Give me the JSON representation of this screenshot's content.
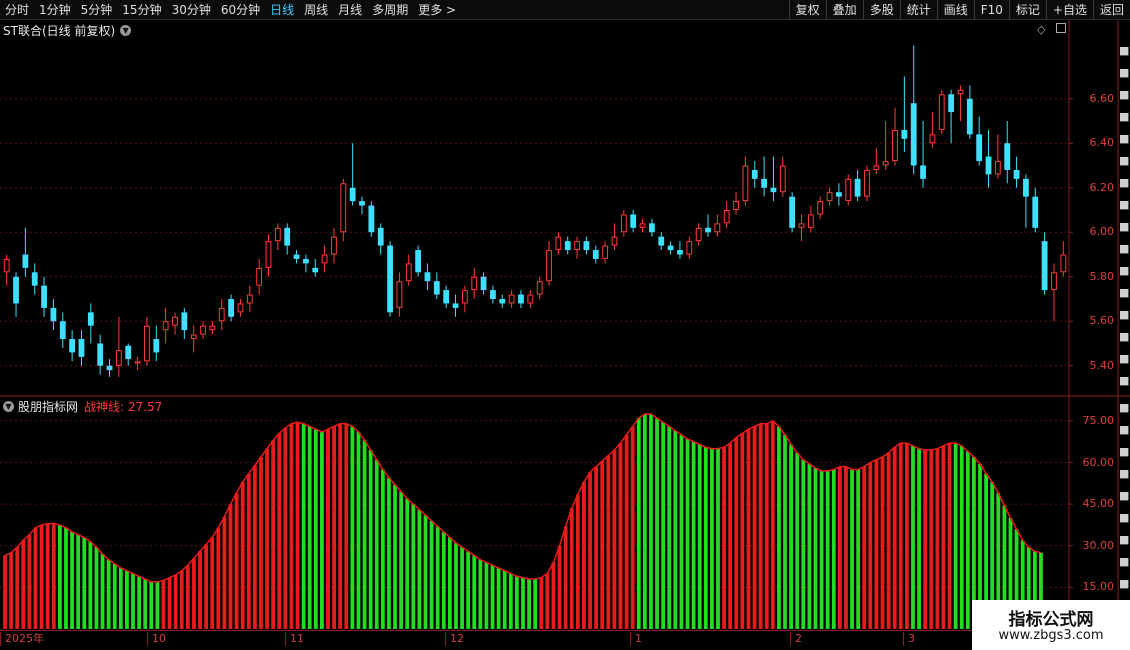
{
  "toolbar": {
    "left": [
      "分时",
      "1分钟",
      "5分钟",
      "15分钟",
      "30分钟",
      "60分钟",
      "日线",
      "周线",
      "月线",
      "多周期",
      "更多 >"
    ],
    "active": "日线",
    "right": [
      "复权",
      "叠加",
      "多股",
      "统计",
      "画线",
      "F10",
      "标记",
      "+自选",
      "返回"
    ]
  },
  "main": {
    "title": "ST联合(日线 前复权)",
    "price_axis": [
      "6.60",
      "6.40",
      "6.20",
      "6.00",
      "5.80",
      "5.60",
      "5.40"
    ]
  },
  "indicator": {
    "site": "股朋指标网",
    "line_label": "战神线: 27.57",
    "axis": [
      "75.00",
      "60.00",
      "45.00",
      "30.00",
      "15.00"
    ]
  },
  "dates": [
    "2025年",
    "10",
    "11",
    "12",
    "1",
    "2",
    "3"
  ],
  "watermark": {
    "line1": "指标公式网",
    "line2": "www.zbgs3.com"
  },
  "colors": {
    "up": "#ff3b3b",
    "down": "#3ee0ff",
    "bar_up": "#e81c1c",
    "bar_down": "#22dd22",
    "axis": "#e04040",
    "grid": "#5a1010"
  },
  "chart_data": [
    {
      "type": "candlestick",
      "ylim": [
        5.3,
        6.9
      ],
      "candles": [
        [
          5.82,
          5.88,
          5.76,
          5.9
        ],
        [
          5.8,
          5.68,
          5.62,
          5.82
        ],
        [
          5.9,
          5.84,
          5.8,
          6.02
        ],
        [
          5.82,
          5.76,
          5.72,
          5.86
        ],
        [
          5.76,
          5.66,
          5.62,
          5.8
        ],
        [
          5.66,
          5.6,
          5.56,
          5.7
        ],
        [
          5.6,
          5.52,
          5.48,
          5.64
        ],
        [
          5.52,
          5.46,
          5.42,
          5.56
        ],
        [
          5.52,
          5.44,
          5.4,
          5.56
        ],
        [
          5.64,
          5.58,
          5.5,
          5.68
        ],
        [
          5.5,
          5.4,
          5.36,
          5.54
        ],
        [
          5.4,
          5.38,
          5.35,
          5.43
        ],
        [
          5.4,
          5.47,
          5.35,
          5.62
        ],
        [
          5.49,
          5.43,
          5.4,
          5.5
        ],
        [
          5.41,
          5.42,
          5.38,
          5.44
        ],
        [
          5.42,
          5.58,
          5.4,
          5.62
        ],
        [
          5.52,
          5.46,
          5.42,
          5.58
        ],
        [
          5.56,
          5.6,
          5.5,
          5.66
        ],
        [
          5.58,
          5.62,
          5.54,
          5.64
        ],
        [
          5.64,
          5.56,
          5.52,
          5.66
        ],
        [
          5.52,
          5.54,
          5.46,
          5.58
        ],
        [
          5.54,
          5.58,
          5.52,
          5.6
        ],
        [
          5.56,
          5.58,
          5.54,
          5.6
        ],
        [
          5.6,
          5.66,
          5.56,
          5.7
        ],
        [
          5.7,
          5.62,
          5.6,
          5.72
        ],
        [
          5.64,
          5.68,
          5.62,
          5.7
        ],
        [
          5.68,
          5.72,
          5.64,
          5.76
        ],
        [
          5.76,
          5.84,
          5.72,
          5.88
        ],
        [
          5.84,
          5.96,
          5.8,
          5.99
        ],
        [
          5.96,
          6.02,
          5.92,
          6.04
        ],
        [
          6.02,
          5.94,
          5.9,
          6.04
        ],
        [
          5.9,
          5.88,
          5.86,
          5.92
        ],
        [
          5.88,
          5.86,
          5.82,
          5.9
        ],
        [
          5.84,
          5.82,
          5.8,
          5.88
        ],
        [
          5.86,
          5.9,
          5.82,
          5.94
        ],
        [
          5.9,
          5.98,
          5.86,
          6.02
        ],
        [
          6.0,
          6.22,
          5.96,
          6.24
        ],
        [
          6.2,
          6.14,
          6.12,
          6.4
        ],
        [
          6.14,
          6.12,
          6.08,
          6.16
        ],
        [
          6.12,
          6.0,
          5.98,
          6.14
        ],
        [
          6.02,
          5.94,
          5.9,
          6.04
        ],
        [
          5.94,
          5.64,
          5.62,
          5.96
        ],
        [
          5.66,
          5.78,
          5.62,
          5.82
        ],
        [
          5.78,
          5.86,
          5.76,
          5.9
        ],
        [
          5.92,
          5.82,
          5.8,
          5.94
        ],
        [
          5.82,
          5.78,
          5.74,
          5.86
        ],
        [
          5.78,
          5.72,
          5.7,
          5.82
        ],
        [
          5.74,
          5.68,
          5.66,
          5.76
        ],
        [
          5.68,
          5.66,
          5.62,
          5.72
        ],
        [
          5.68,
          5.74,
          5.64,
          5.76
        ],
        [
          5.74,
          5.8,
          5.7,
          5.84
        ],
        [
          5.8,
          5.74,
          5.72,
          5.82
        ],
        [
          5.74,
          5.7,
          5.68,
          5.76
        ],
        [
          5.7,
          5.68,
          5.66,
          5.72
        ],
        [
          5.68,
          5.72,
          5.66,
          5.74
        ],
        [
          5.72,
          5.68,
          5.66,
          5.74
        ],
        [
          5.68,
          5.72,
          5.66,
          5.74
        ],
        [
          5.72,
          5.78,
          5.7,
          5.8
        ],
        [
          5.78,
          5.92,
          5.76,
          5.96
        ],
        [
          5.92,
          5.98,
          5.9,
          6.0
        ],
        [
          5.96,
          5.92,
          5.9,
          5.98
        ],
        [
          5.92,
          5.96,
          5.88,
          5.98
        ],
        [
          5.96,
          5.92,
          5.9,
          5.98
        ],
        [
          5.92,
          5.88,
          5.86,
          5.94
        ],
        [
          5.88,
          5.94,
          5.86,
          5.96
        ],
        [
          5.94,
          5.98,
          5.92,
          6.04
        ],
        [
          6.0,
          6.08,
          5.98,
          6.1
        ],
        [
          6.08,
          6.02,
          6.0,
          6.1
        ],
        [
          6.02,
          6.04,
          6.0,
          6.06
        ],
        [
          6.04,
          6.0,
          5.98,
          6.06
        ],
        [
          5.98,
          5.94,
          5.92,
          6.0
        ],
        [
          5.94,
          5.92,
          5.9,
          5.96
        ],
        [
          5.92,
          5.9,
          5.88,
          5.96
        ],
        [
          5.9,
          5.96,
          5.88,
          5.98
        ],
        [
          5.96,
          6.02,
          5.94,
          6.04
        ],
        [
          6.02,
          6.0,
          5.98,
          6.08
        ],
        [
          6.0,
          6.04,
          5.98,
          6.08
        ],
        [
          6.04,
          6.1,
          6.02,
          6.14
        ],
        [
          6.1,
          6.14,
          6.08,
          6.18
        ],
        [
          6.14,
          6.3,
          6.12,
          6.34
        ],
        [
          6.28,
          6.24,
          6.2,
          6.32
        ],
        [
          6.24,
          6.2,
          6.16,
          6.34
        ],
        [
          6.2,
          6.18,
          6.14,
          6.34
        ],
        [
          6.18,
          6.3,
          6.16,
          6.34
        ],
        [
          6.16,
          6.02,
          6.0,
          6.18
        ],
        [
          6.02,
          6.04,
          5.96,
          6.08
        ],
        [
          6.02,
          6.08,
          6.0,
          6.12
        ],
        [
          6.08,
          6.14,
          6.06,
          6.16
        ],
        [
          6.14,
          6.18,
          6.12,
          6.2
        ],
        [
          6.18,
          6.16,
          6.12,
          6.22
        ],
        [
          6.14,
          6.24,
          6.12,
          6.26
        ],
        [
          6.24,
          6.16,
          6.14,
          6.28
        ],
        [
          6.16,
          6.28,
          6.14,
          6.3
        ],
        [
          6.28,
          6.3,
          6.26,
          6.38
        ],
        [
          6.3,
          6.32,
          6.28,
          6.5
        ],
        [
          6.32,
          6.46,
          6.3,
          6.56
        ],
        [
          6.46,
          6.42,
          6.36,
          6.7
        ],
        [
          6.58,
          6.3,
          6.26,
          6.84
        ],
        [
          6.3,
          6.24,
          6.2,
          6.5
        ],
        [
          6.4,
          6.44,
          6.38,
          6.54
        ],
        [
          6.46,
          6.62,
          6.44,
          6.64
        ],
        [
          6.62,
          6.54,
          6.4,
          6.64
        ],
        [
          6.62,
          6.64,
          6.5,
          6.66
        ],
        [
          6.6,
          6.44,
          6.42,
          6.66
        ],
        [
          6.44,
          6.32,
          6.3,
          6.52
        ],
        [
          6.34,
          6.26,
          6.2,
          6.46
        ],
        [
          6.26,
          6.32,
          6.24,
          6.44
        ],
        [
          6.4,
          6.28,
          6.22,
          6.5
        ],
        [
          6.28,
          6.24,
          6.2,
          6.34
        ],
        [
          6.24,
          6.16,
          6.02,
          6.26
        ],
        [
          6.16,
          6.02,
          6.0,
          6.2
        ],
        [
          5.96,
          5.74,
          5.72,
          6.0
        ],
        [
          5.74,
          5.82,
          5.6,
          5.86
        ],
        [
          5.82,
          5.9,
          5.8,
          5.96
        ]
      ]
    },
    {
      "type": "bar",
      "title": "战神线",
      "ylim": [
        0,
        80
      ],
      "values": [
        26.5,
        27.5,
        29.5,
        32,
        34,
        36.5,
        37.5,
        38,
        38,
        37.5,
        36.5,
        35,
        34,
        33,
        31.5,
        29.5,
        27,
        25,
        23.5,
        22,
        21,
        20,
        19,
        18,
        17,
        17,
        17.5,
        18.5,
        19.5,
        21,
        23,
        25.5,
        28,
        30.5,
        33,
        36.5,
        40.5,
        45,
        49,
        53,
        56,
        59,
        62,
        65,
        68,
        70.5,
        72.5,
        74,
        74.5,
        74,
        73,
        72,
        71,
        72,
        73,
        74,
        74,
        73,
        71,
        68,
        64.5,
        61,
        57.5,
        54.5,
        52,
        49.5,
        47,
        45,
        43,
        41,
        39,
        37,
        35,
        33,
        31,
        29.5,
        28,
        26.5,
        25,
        24,
        23,
        22,
        21,
        20,
        19,
        18.5,
        18,
        18,
        18.5,
        20,
        24,
        30,
        37,
        43.5,
        48.5,
        53,
        56.5,
        58.5,
        60.5,
        62.5,
        64.5,
        67,
        70,
        73,
        76,
        77.5,
        77.5,
        76,
        74.5,
        73,
        71.5,
        70,
        68.5,
        67.5,
        66.5,
        65.5,
        65,
        65,
        65.5,
        67,
        69,
        70.5,
        72,
        73,
        74,
        74,
        75,
        73,
        70,
        66.5,
        63.5,
        61,
        59.5,
        58,
        57,
        57,
        57.5,
        58.5,
        58.5,
        57.5,
        57.5,
        58.5,
        60,
        61,
        62,
        63.5,
        65.5,
        67,
        67,
        66,
        65,
        64.5,
        64.5,
        65,
        66,
        67,
        67,
        66,
        64,
        62,
        59.5,
        56,
        53,
        49,
        44.5,
        40,
        36,
        32,
        29.5,
        28,
        27.5
      ],
      "bar_colors": [
        "r",
        "r",
        "r",
        "r",
        "r",
        "r",
        "r",
        "r",
        "r",
        "g",
        "g",
        "g",
        "g",
        "g",
        "g",
        "g",
        "g",
        "g",
        "g",
        "g",
        "g",
        "g",
        "g",
        "g",
        "g",
        "g",
        "r",
        "r",
        "r",
        "r",
        "r",
        "r",
        "r",
        "r",
        "r",
        "r",
        "r",
        "r",
        "r",
        "r",
        "r",
        "r",
        "r",
        "r",
        "r",
        "r",
        "r",
        "r",
        "r",
        "g",
        "g",
        "g",
        "g",
        "r",
        "r",
        "r",
        "r",
        "g",
        "g",
        "g",
        "g",
        "g",
        "g",
        "g",
        "g",
        "g",
        "g",
        "g",
        "g",
        "g",
        "g",
        "g",
        "g",
        "g",
        "g",
        "g",
        "g",
        "g",
        "g",
        "g",
        "g",
        "g",
        "g",
        "g",
        "g",
        "g",
        "g",
        "g",
        "r",
        "r",
        "r",
        "r",
        "r",
        "r",
        "r",
        "r",
        "r",
        "r",
        "r",
        "r",
        "r",
        "r",
        "r",
        "r",
        "g",
        "g",
        "g",
        "g",
        "g",
        "g",
        "g",
        "g",
        "g",
        "g",
        "g",
        "g",
        "g",
        "g",
        "r",
        "r",
        "r",
        "r",
        "r",
        "r",
        "r",
        "r",
        "r",
        "g",
        "g",
        "g",
        "g",
        "g",
        "g",
        "g",
        "g",
        "g",
        "g",
        "r",
        "r",
        "g",
        "g",
        "r",
        "r",
        "r",
        "r",
        "r",
        "r",
        "r",
        "r",
        "g",
        "g",
        "r",
        "r",
        "r",
        "r",
        "r",
        "g",
        "g",
        "g",
        "g",
        "g",
        "g",
        "g",
        "g",
        "g",
        "g",
        "g",
        "g",
        "g",
        "g",
        "g",
        "g",
        "g"
      ]
    }
  ]
}
